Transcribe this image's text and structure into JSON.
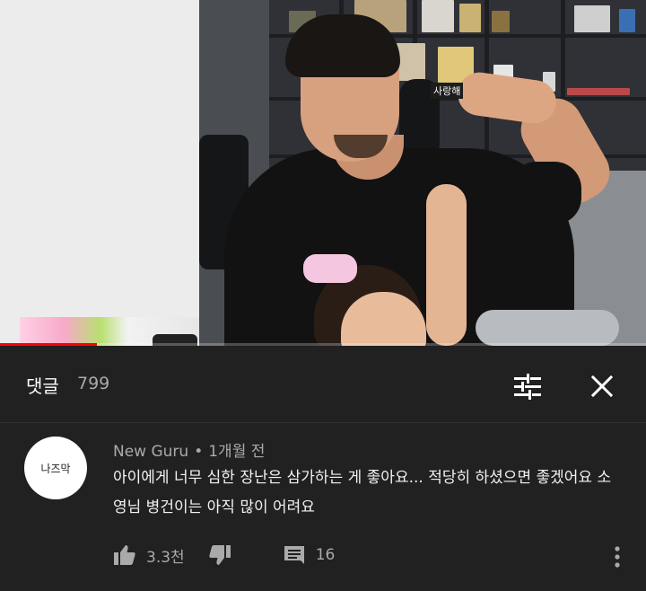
{
  "header": {
    "title": "댓글",
    "count": "799",
    "sort_icon": "sliders-icon",
    "close_icon": "close-icon"
  },
  "video": {
    "progress_fraction": 0.15,
    "shirt_text": "사랑해",
    "colors": {
      "progress": "#ff0000"
    }
  },
  "comment": {
    "avatar_text": "나즈막",
    "author": "New Guru",
    "separator": "•",
    "time": "1개월 전",
    "text": "아이에게 너무 심한 장난은 삼가하는 게 좋아요... 적당히 하셨으면 좋겠어요 소영님 병건이는 아직 많이 어려요",
    "like_icon": "thumbs-up-icon",
    "likes": "3.3천",
    "dislike_icon": "thumbs-down-icon",
    "reply_icon": "comment-icon",
    "replies": "16",
    "more_icon": "more-vert-icon"
  },
  "colors": {
    "background": "#212121",
    "secondary_text": "#aaaaaa",
    "primary_text": "#f1f1f1"
  }
}
